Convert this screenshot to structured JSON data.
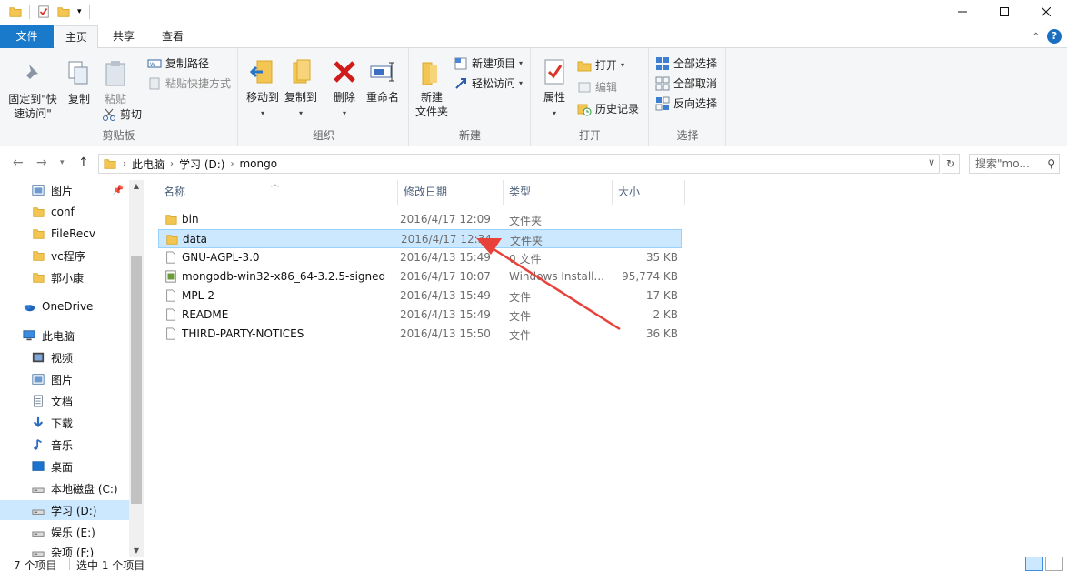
{
  "ribbon_tabs": {
    "file": "文件",
    "home": "主页",
    "share": "共享",
    "view": "查看"
  },
  "clipboard": {
    "label": "剪贴板",
    "pin_quick_access": "固定到\"快\n速访问\"",
    "copy": "复制",
    "paste": "粘贴",
    "cut": "剪切",
    "copy_path": "复制路径",
    "paste_shortcut": "粘贴快捷方式"
  },
  "organize": {
    "label": "组织",
    "move_to": "移动到",
    "copy_to": "复制到",
    "delete": "删除",
    "rename": "重命名"
  },
  "new": {
    "label": "新建",
    "new_folder": "新建\n文件夹",
    "new_item": "新建项目",
    "easy_access": "轻松访问"
  },
  "open": {
    "label": "打开",
    "properties": "属性",
    "open": "打开",
    "edit": "编辑",
    "history": "历史记录"
  },
  "select": {
    "label": "选择",
    "select_all": "全部选择",
    "select_none": "全部取消",
    "invert": "反向选择"
  },
  "address": {
    "crumbs": [
      "此电脑",
      "学习 (D:)",
      "mongo"
    ],
    "search_placeholder": "搜索\"mo..."
  },
  "navpane": {
    "items": [
      {
        "label": "图片",
        "icon": "pictures-icon"
      },
      {
        "label": "conf",
        "icon": "folder-icon"
      },
      {
        "label": "FileRecv",
        "icon": "folder-icon"
      },
      {
        "label": "vc程序",
        "icon": "folder-icon"
      },
      {
        "label": "郭小康",
        "icon": "folder-icon"
      },
      {
        "label": "OneDrive",
        "icon": "onedrive-icon"
      },
      {
        "label": "此电脑",
        "icon": "computer-icon"
      },
      {
        "label": "视频",
        "icon": "videos-icon"
      },
      {
        "label": "图片",
        "icon": "pictures-icon"
      },
      {
        "label": "文档",
        "icon": "documents-icon"
      },
      {
        "label": "下载",
        "icon": "downloads-icon"
      },
      {
        "label": "音乐",
        "icon": "music-icon"
      },
      {
        "label": "桌面",
        "icon": "desktop-icon"
      },
      {
        "label": "本地磁盘 (C:)",
        "icon": "drive-icon"
      },
      {
        "label": "学习 (D:)",
        "icon": "drive-icon"
      },
      {
        "label": "娱乐 (E:)",
        "icon": "drive-icon"
      },
      {
        "label": "杂项 (F:)",
        "icon": "drive-icon"
      }
    ]
  },
  "columns": {
    "name": "名称",
    "date": "修改日期",
    "type": "类型",
    "size": "大小"
  },
  "files": [
    {
      "name": "bin",
      "date": "2016/4/17 12:09",
      "type": "文件夹",
      "size": "",
      "icon": "folder-icon"
    },
    {
      "name": "data",
      "date": "2016/4/17 12:34",
      "type": "文件夹",
      "size": "",
      "icon": "folder-icon"
    },
    {
      "name": "GNU-AGPL-3.0",
      "date": "2016/4/13 15:49",
      "type": "0 文件",
      "size": "35 KB",
      "icon": "file-icon"
    },
    {
      "name": "mongodb-win32-x86_64-3.2.5-signed",
      "date": "2016/4/17 10:07",
      "type": "Windows Install...",
      "size": "95,774 KB",
      "icon": "installer-icon"
    },
    {
      "name": "MPL-2",
      "date": "2016/4/13 15:49",
      "type": "文件",
      "size": "17 KB",
      "icon": "file-icon"
    },
    {
      "name": "README",
      "date": "2016/4/13 15:49",
      "type": "文件",
      "size": "2 KB",
      "icon": "file-icon"
    },
    {
      "name": "THIRD-PARTY-NOTICES",
      "date": "2016/4/13 15:50",
      "type": "文件",
      "size": "36 KB",
      "icon": "file-icon"
    }
  ],
  "status": {
    "count": "7 个项目",
    "selected": "选中 1 个项目"
  },
  "colors": {
    "accent": "#1979ca",
    "selection": "#cce8ff",
    "arrow": "#e8413a",
    "folder": "#f3c552"
  }
}
